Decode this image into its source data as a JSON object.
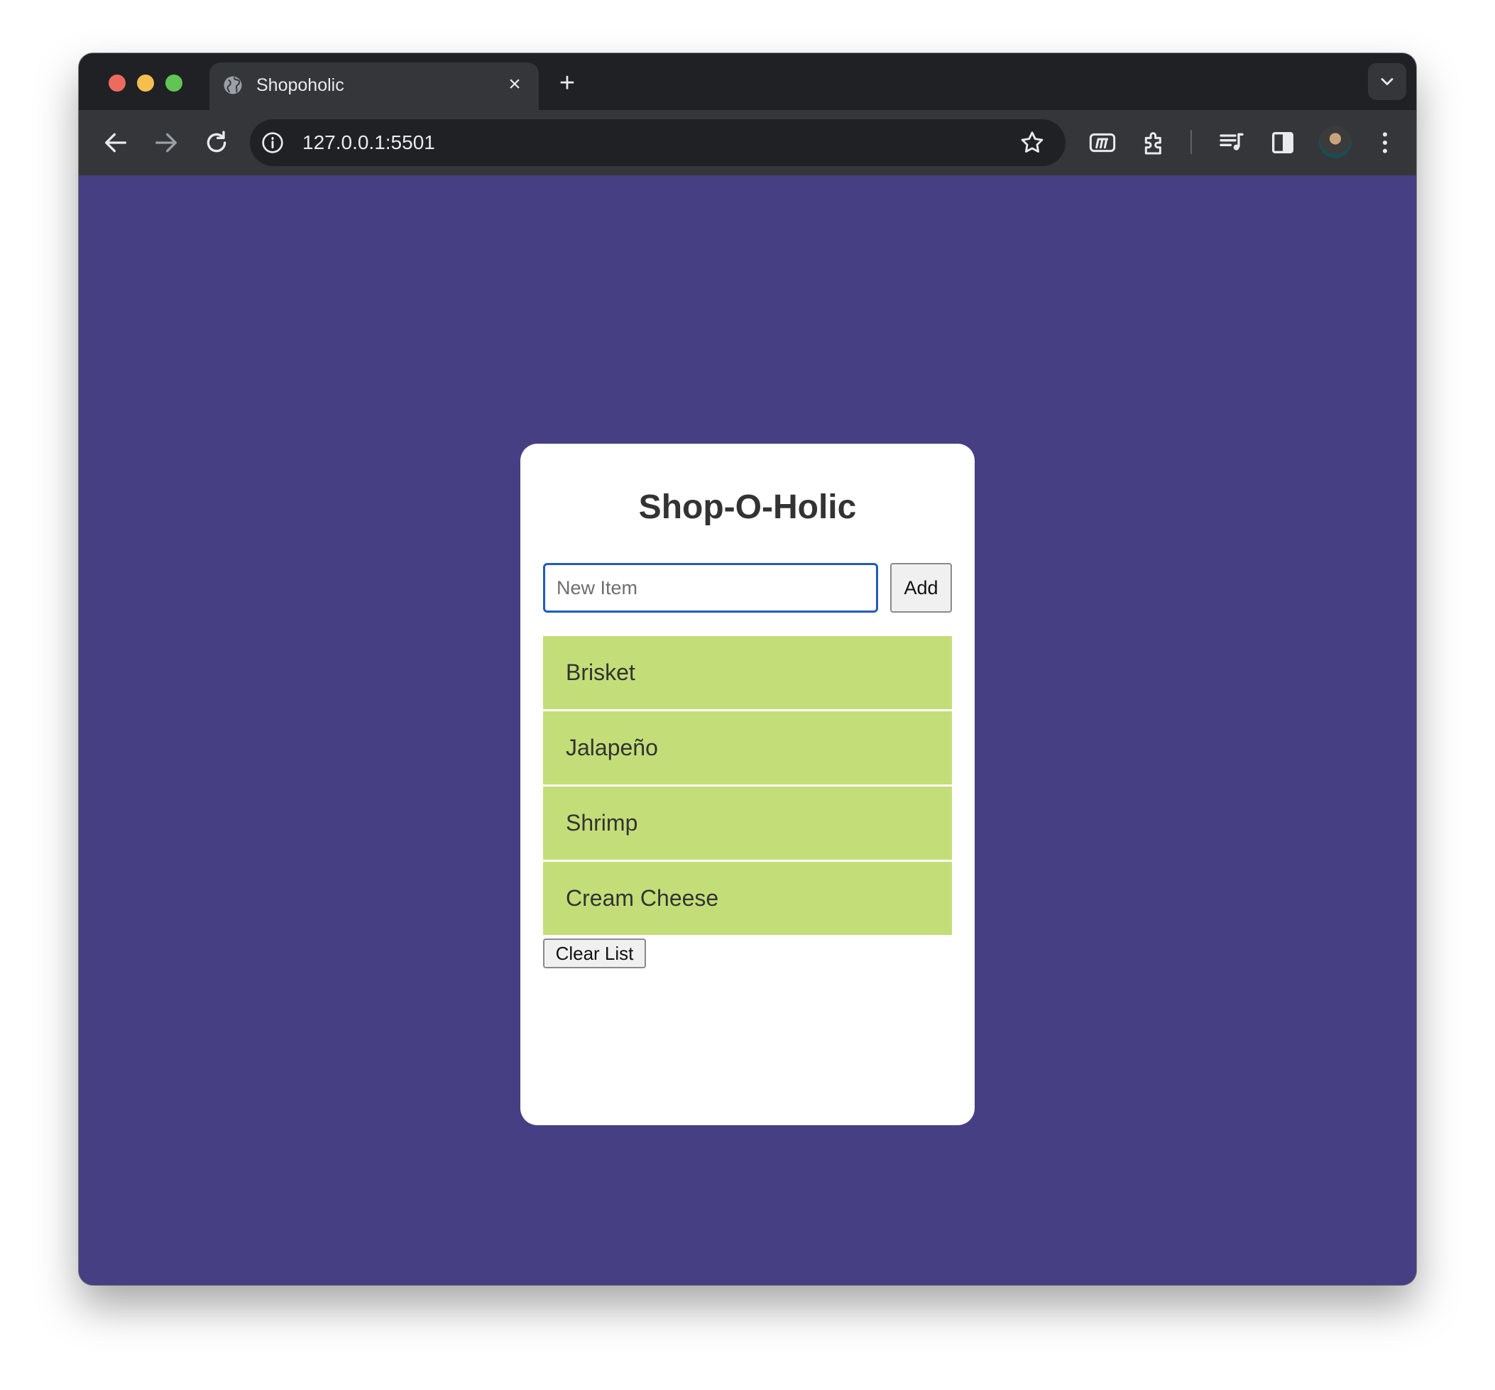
{
  "browser": {
    "tab_title": "Shopoholic",
    "url": "127.0.0.1:5501",
    "icons": {
      "back": "arrow-left-icon",
      "forward": "arrow-right-icon",
      "reload": "reload-icon",
      "site_info": "info-icon",
      "bookmark": "star-icon",
      "extension_m": "m-extension-icon",
      "extensions": "puzzle-icon",
      "media": "media-playlist-icon",
      "side_panel": "side-panel-icon",
      "menu": "kebab-menu-icon"
    }
  },
  "app": {
    "title": "Shop-O-Holic",
    "input_placeholder": "New Item",
    "input_value": "",
    "add_label": "Add",
    "items": [
      "Brisket",
      "Jalapeño",
      "Shrimp",
      "Cream Cheese"
    ],
    "clear_label": "Clear List"
  },
  "colors": {
    "page_background": "#463f84",
    "item_background": "#c3de78",
    "input_focus_border": "#1f5bbf"
  }
}
